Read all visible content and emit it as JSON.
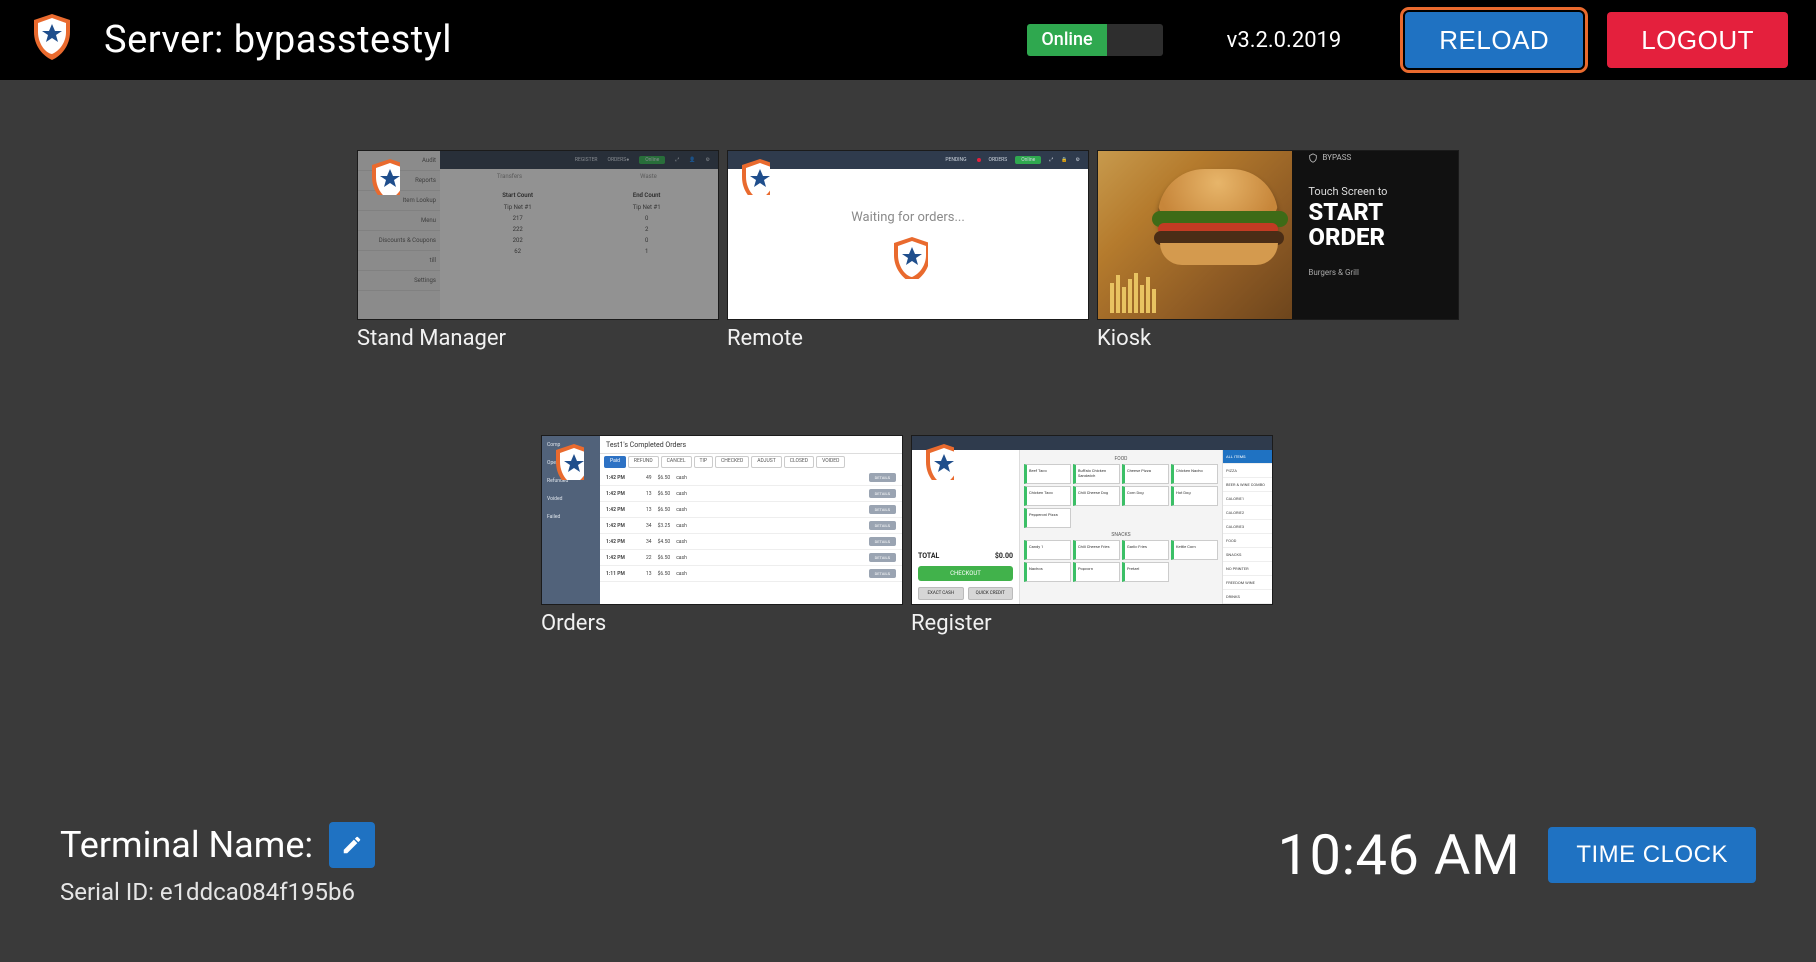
{
  "header": {
    "server_prefix": "Server:",
    "server_name": "bypasstestyl",
    "status": "Online",
    "version": "v3.2.0.2019",
    "reload": "RELOAD",
    "logout": "LOGOUT"
  },
  "tiles": {
    "stand_manager": {
      "label": "Stand Manager",
      "side": [
        "Audit",
        "Reports",
        "Item Lookup",
        "Menu",
        "Discounts & Coupons",
        "till",
        "Settings"
      ],
      "tabs": [
        "Transfers",
        "Waste"
      ],
      "cols": [
        "Start Count",
        "End Count"
      ],
      "rows": [
        {
          "a": "Tip Net #1",
          "b": "Tip Net #1"
        },
        {
          "a": "217",
          "b": "0"
        },
        {
          "a": "222",
          "b": "2"
        },
        {
          "a": "202",
          "b": "0"
        },
        {
          "a": "62",
          "b": "1"
        }
      ]
    },
    "remote": {
      "label": "Remote",
      "message": "Waiting for orders...",
      "top": {
        "pending": "PENDING",
        "orders": "ORDERS",
        "status": "Online"
      }
    },
    "kiosk": {
      "label": "Kiosk",
      "brand": "BYPASS",
      "line1": "Touch Screen to",
      "line2": "START",
      "line3": "ORDER",
      "sub": "Burgers & Grill"
    },
    "orders": {
      "label": "Orders",
      "title": "Test1's Completed Orders",
      "side": [
        "Comp",
        "Open Tabs",
        "Refunded",
        "Voided",
        "Failed"
      ],
      "tabs": [
        "Paid",
        "REFUND",
        "CANCEL",
        "TIP",
        "CHECKED",
        "ADJUST",
        "CLOSED",
        "VOIDED"
      ],
      "rows": [
        {
          "t": "1:42 PM",
          "n": "49",
          "a": "$6.50",
          "s": "cash"
        },
        {
          "t": "1:42 PM",
          "n": "13",
          "a": "$6.50",
          "s": "cash"
        },
        {
          "t": "1:42 PM",
          "n": "13",
          "a": "$6.50",
          "s": "cash"
        },
        {
          "t": "1:42 PM",
          "n": "34",
          "a": "$3.25",
          "s": "cash"
        },
        {
          "t": "1:42 PM",
          "n": "34",
          "a": "$4.50",
          "s": "cash"
        },
        {
          "t": "1:42 PM",
          "n": "22",
          "a": "$6.50",
          "s": "cash"
        },
        {
          "t": "1:11 PM",
          "n": "13",
          "a": "$6.50",
          "s": "cash"
        }
      ]
    },
    "register": {
      "label": "Register",
      "total_label": "TOTAL",
      "total_value": "$0.00",
      "checkout": "CHECKOUT",
      "pay": [
        "EXACT CASH",
        "QUICK CREDIT"
      ],
      "sec_food": "FOOD",
      "food": [
        "Beef Taco",
        "Buffalo Chicken Sandwich",
        "Cheese Pizza",
        "Chicken Nacho",
        "Chicken Taco",
        "Chili Cheese Dog",
        "Corn Dog",
        "Hot Dog",
        "Pepperoni Pizza"
      ],
      "sec_snacks": "SNACKS",
      "snacks": [
        "Candy 1",
        "Chili Cheese Fries",
        "Garlic Fries",
        "Kettle Corn",
        "Nachos",
        "Popcorn",
        "Pretzel"
      ],
      "cats": [
        "PIZZA",
        "BEER & WINE COMBO",
        "CALORIE1",
        "CALORIE2",
        "CALORIE3",
        "FOOD",
        "SNACKS",
        "NO PRINTER",
        "FREEDOM WINE",
        "DRINKS"
      ],
      "top_label": "ALL ITEMS"
    }
  },
  "footer": {
    "terminal_label": "Terminal Name:",
    "serial_prefix": "Serial ID:",
    "serial_value": "e1ddca084f195b6",
    "clock": "10:46 AM",
    "timeclock": "TIME CLOCK"
  }
}
